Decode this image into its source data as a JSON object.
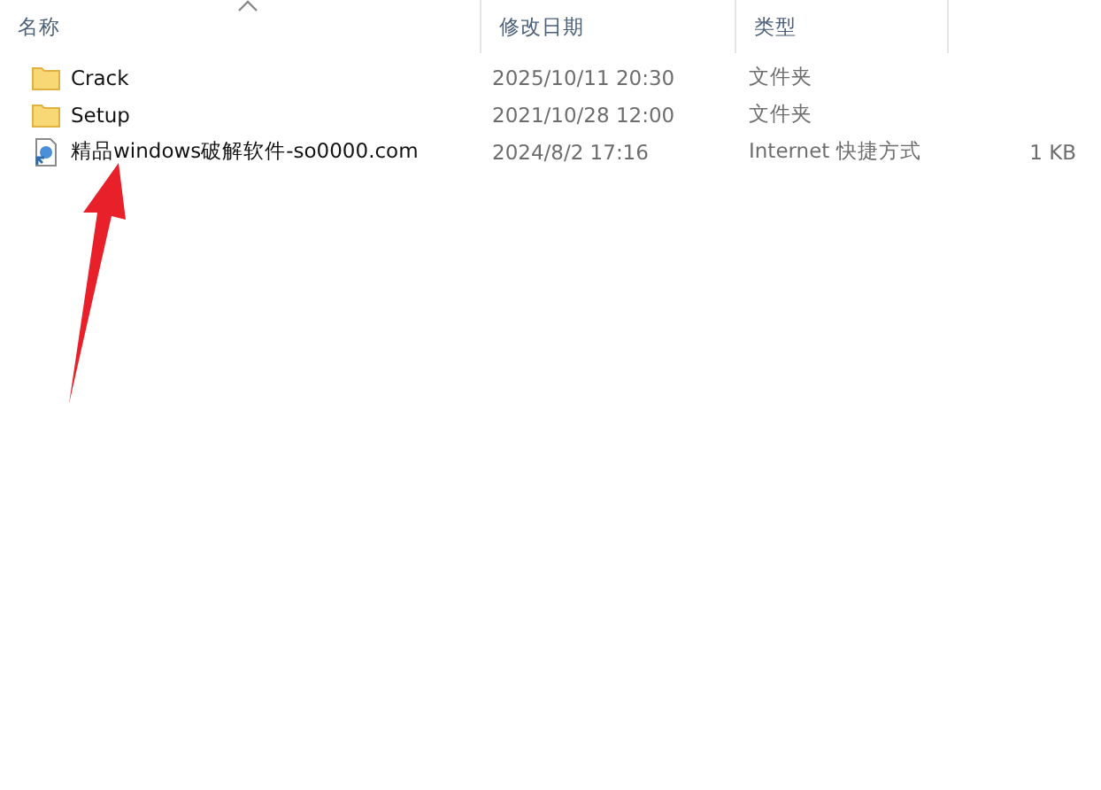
{
  "columns": [
    {
      "label": "名称",
      "sorted": true
    },
    {
      "label": "修改日期",
      "sorted": false
    },
    {
      "label": "类型",
      "sorted": false
    }
  ],
  "rows": [
    {
      "kind": "folder",
      "name": "Crack",
      "date": "2025/10/11 20:30",
      "type": "文件夹"
    },
    {
      "kind": "folder",
      "name": "Setup",
      "date": "2021/10/28 12:00",
      "type": "文件夹"
    },
    {
      "kind": "shortcut",
      "name": "精品windows破解软件-so0000.com",
      "date": "2024/8/2 17:16",
      "type": "Internet 快捷方式",
      "size": "1 KB"
    }
  ]
}
